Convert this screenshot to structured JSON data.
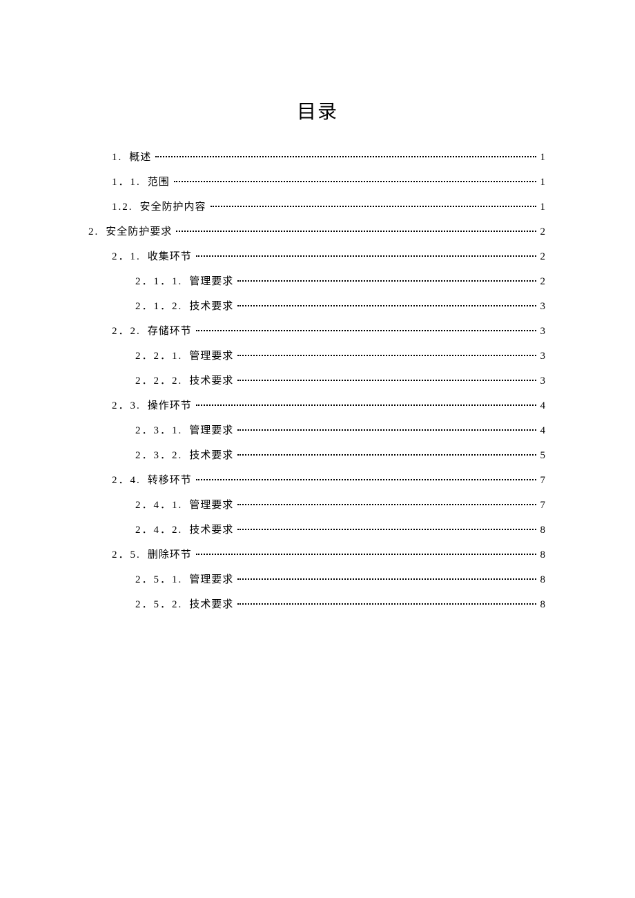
{
  "title": "目录",
  "entries": [
    {
      "level": 1,
      "num": "1.",
      "text": "概述",
      "page": "1"
    },
    {
      "level": 1,
      "num": "1．1.",
      "text": "范围",
      "page": "1"
    },
    {
      "level": 1,
      "num": "1.2.",
      "text": "安全防护内容",
      "page": "1"
    },
    {
      "level": 0,
      "num": "2.",
      "text": "安全防护要求",
      "page": "2"
    },
    {
      "level": 1,
      "num": "2．1.",
      "text": "收集环节",
      "page": "2"
    },
    {
      "level": 2,
      "num": "2．1．1.",
      "text": "管理要求",
      "page": "2"
    },
    {
      "level": 2,
      "num": "2．1．2.",
      "text": "技术要求",
      "page": "3"
    },
    {
      "level": 1,
      "num": "2．2.",
      "text": "存储环节",
      "page": "3"
    },
    {
      "level": 2,
      "num": "2．2．1.",
      "text": "管理要求",
      "page": "3"
    },
    {
      "level": 2,
      "num": "2．2．2.",
      "text": "技术要求",
      "page": "3"
    },
    {
      "level": 1,
      "num": "2．3.",
      "text": "操作环节",
      "page": "4"
    },
    {
      "level": 2,
      "num": "2．3．1.",
      "text": "管理要求",
      "page": "4"
    },
    {
      "level": 2,
      "num": "2．3．2.",
      "text": "技术要求",
      "page": "5"
    },
    {
      "level": 1,
      "num": "2．4.",
      "text": "转移环节",
      "page": "7"
    },
    {
      "level": 2,
      "num": "2．4．1.",
      "text": "管理要求",
      "page": "7"
    },
    {
      "level": 2,
      "num": "2．4．2.",
      "text": "技术要求",
      "page": "8"
    },
    {
      "level": 1,
      "num": "2．5.",
      "text": "删除环节",
      "page": "8"
    },
    {
      "level": 2,
      "num": "2．5．1.",
      "text": "管理要求",
      "page": "8"
    },
    {
      "level": 2,
      "num": "2．5．2.",
      "text": "技术要求",
      "page": "8"
    }
  ]
}
